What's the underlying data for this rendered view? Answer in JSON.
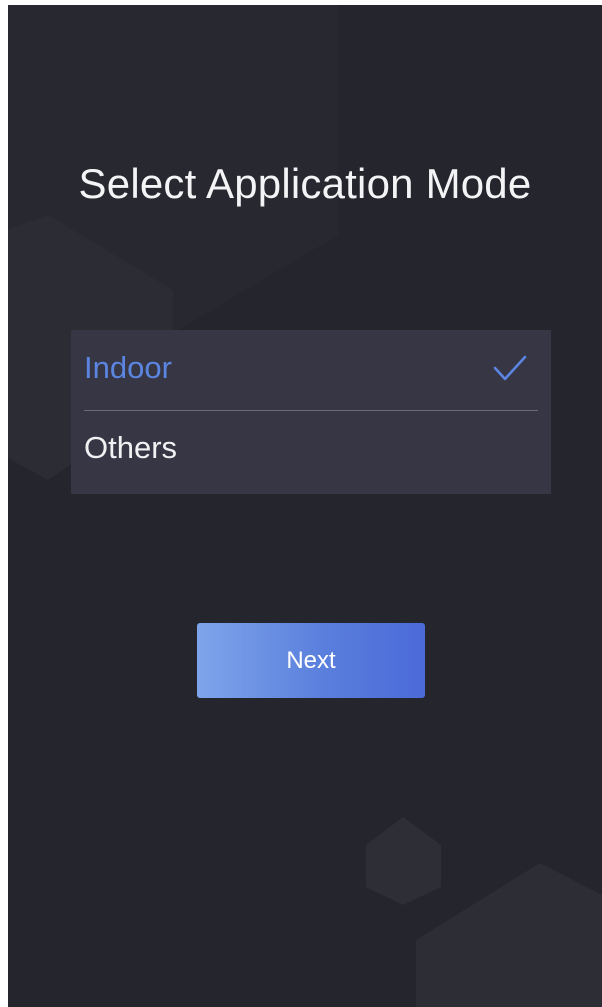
{
  "screen": {
    "title": "Select Application Mode",
    "background_color": "#25262d",
    "accent_color": "#5b85e0"
  },
  "mode_options": [
    {
      "label": "Indoor",
      "selected": true,
      "icon": "checkmark-icon"
    },
    {
      "label": "Others",
      "selected": false
    }
  ],
  "next_button": {
    "label": "Next"
  }
}
